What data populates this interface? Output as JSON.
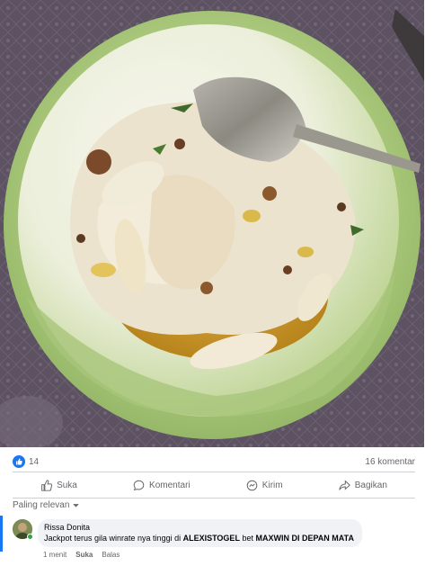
{
  "post": {
    "image_alt": "Bowl of food with spoon",
    "reaction_icon": "like-icon",
    "reaction_count": "14",
    "comment_count": "16 komentar"
  },
  "actions": {
    "like_label": "Suka",
    "comment_label": "Komentari",
    "send_label": "Kirim",
    "share_label": "Bagikan"
  },
  "sort": {
    "label": "Paling relevan"
  },
  "comments": [
    {
      "author": "Rissa Donita",
      "text_prefix": "Jackpot terus gila winrate nya tinggi di ",
      "text_bold_1": "ALEXISTOGEL",
      "text_middle": " bet ",
      "text_bold_2": "MAXWIN DI DEPAN MATA",
      "time": "1 menit",
      "like_label": "Suka",
      "reply_label": "Balas"
    }
  ],
  "colors": {
    "accent": "#1877f2",
    "muted": "#65676b",
    "bubble": "#f0f2f5"
  }
}
